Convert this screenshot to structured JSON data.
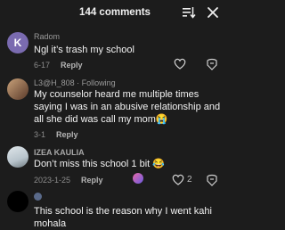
{
  "header": {
    "title": "144 comments",
    "filter_icon": "sort-filter-icon",
    "close_icon": "close-icon"
  },
  "comments": [
    {
      "username": "Radom",
      "avatar_letter": "K",
      "avatar_color": "#7a6bb0",
      "text": "Ngl it’s trash my school",
      "date": "6-17",
      "reply": "Reply",
      "likes": ""
    },
    {
      "username": "L3@H_808 · Following",
      "avatar_letter": "",
      "text": "My counselor heard me multiple times saying I was in an abusive relationship and all she did was call my mom😭",
      "date": "3-1",
      "reply": "Reply",
      "likes": ""
    },
    {
      "username": "IZEA KAULIA",
      "avatar_letter": "",
      "text": "Don’t miss this school 1 bit 😂",
      "date": "2023-1-25",
      "reply": "Reply",
      "likes": "2"
    },
    {
      "username": "",
      "avatar_letter": "",
      "text": "This school is the reason why I went kahi mohala",
      "date": "",
      "reply": "",
      "likes": ""
    }
  ],
  "colors": {
    "background": "#1c1c1c",
    "muted": "#8c8c8c",
    "accent": "#7a6bb0"
  }
}
